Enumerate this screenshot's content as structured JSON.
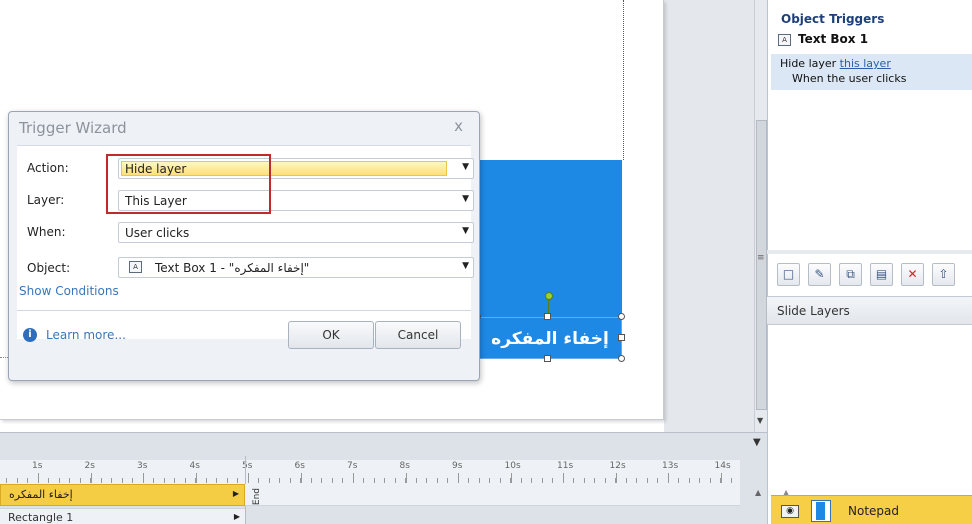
{
  "dialog": {
    "title": "Trigger Wizard",
    "close_glyph": "x",
    "action_label": "Action:",
    "action_value": "Hide layer",
    "layer_label": "Layer:",
    "layer_value": "This Layer",
    "when_label": "When:",
    "when_value": "User clicks",
    "object_label": "Object:",
    "object_value": "Text Box 1 - \"إخفاء المفكره\"",
    "show_conditions": "Show Conditions",
    "learn_more": "Learn more...",
    "ok_label": "OK",
    "cancel_label": "Cancel"
  },
  "canvas": {
    "text_box_label": "إخفاء المفكره"
  },
  "timeline": {
    "ticks": [
      "1s",
      "2s",
      "3s",
      "4s",
      "5s",
      "6s",
      "7s",
      "8s",
      "9s",
      "10s",
      "11s",
      "12s",
      "13s",
      "14s"
    ],
    "row1_label": "إخفاء المفكره",
    "row2_label": "Rectangle 1",
    "end_label": "End"
  },
  "triggers_panel": {
    "title": "Object Triggers",
    "object_label": "Text Box 1",
    "action_prefix": "Hide layer",
    "action_link": "this layer",
    "when_text": "When the user clicks"
  },
  "layers_panel": {
    "title": "Slide Layers",
    "notepad_label": "Notepad"
  },
  "colors": {
    "accent_blue": "#1e88e5",
    "highlight_yellow": "#f6cf47",
    "annotation_red": "#c0292e",
    "link_blue": "#3a76b8"
  }
}
